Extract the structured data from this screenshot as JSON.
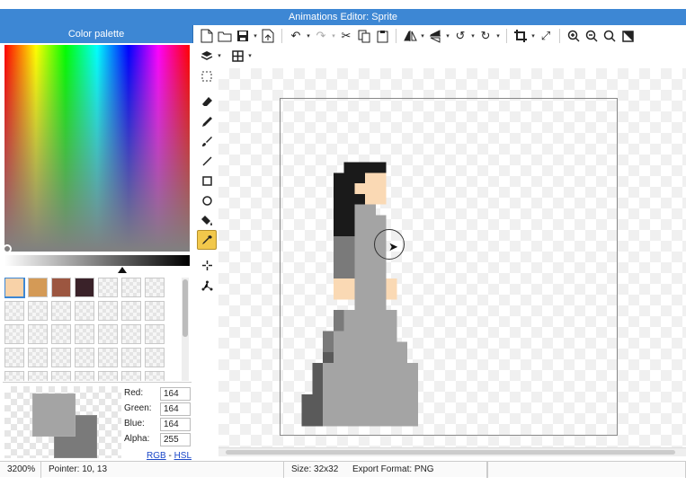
{
  "window": {
    "title": "Animations Editor: Sprite"
  },
  "palette": {
    "header": "Color palette",
    "swatches": [
      {
        "color": "#f8d2a8",
        "selected": true
      },
      {
        "color": "#d49a56"
      },
      {
        "color": "#9c5640"
      },
      {
        "color": "#3a2229"
      }
    ],
    "primary_color": "#a4a4a4",
    "secondary_color": "#7a7a7a"
  },
  "color_values": {
    "red_label": "Red:",
    "red": "164",
    "green_label": "Green:",
    "green": "164",
    "blue_label": "Blue:",
    "blue": "164",
    "alpha_label": "Alpha:",
    "alpha": "255",
    "rgb_link": "RGB",
    "separator": " - ",
    "hsl_link": "HSL"
  },
  "toolbar": {
    "icons": [
      "new-file-icon",
      "open-folder-icon",
      "save-icon",
      "export-icon",
      "undo-icon",
      "redo-icon",
      "cut-icon",
      "copy-icon",
      "paste-icon",
      "flip-horizontal-icon",
      "flip-vertical-icon",
      "rotate-left-icon",
      "rotate-right-icon",
      "crop-icon",
      "resize-icon",
      "zoom-in-icon",
      "zoom-out-icon",
      "zoom-fit-icon",
      "fullscreen-icon",
      "layers-icon",
      "grid-icon"
    ]
  },
  "tools": [
    "select",
    "eraser",
    "pencil",
    "brush",
    "line",
    "rectangle",
    "ellipse",
    "fill",
    "color-picker",
    "magic-wand",
    "transform"
  ],
  "active_tool": "color-picker",
  "status": {
    "zoom": "3200%",
    "pointer": "Pointer: 10, 13",
    "size": "Size: 32x32",
    "export_format": "Export Format: PNG"
  },
  "sprite_colors": {
    "hair": "#1a1a1a",
    "skin": "#fad9b4",
    "dress": "#a4a4a4",
    "shadow": "#7a7a7a",
    "dark": "#5a5a5a"
  }
}
